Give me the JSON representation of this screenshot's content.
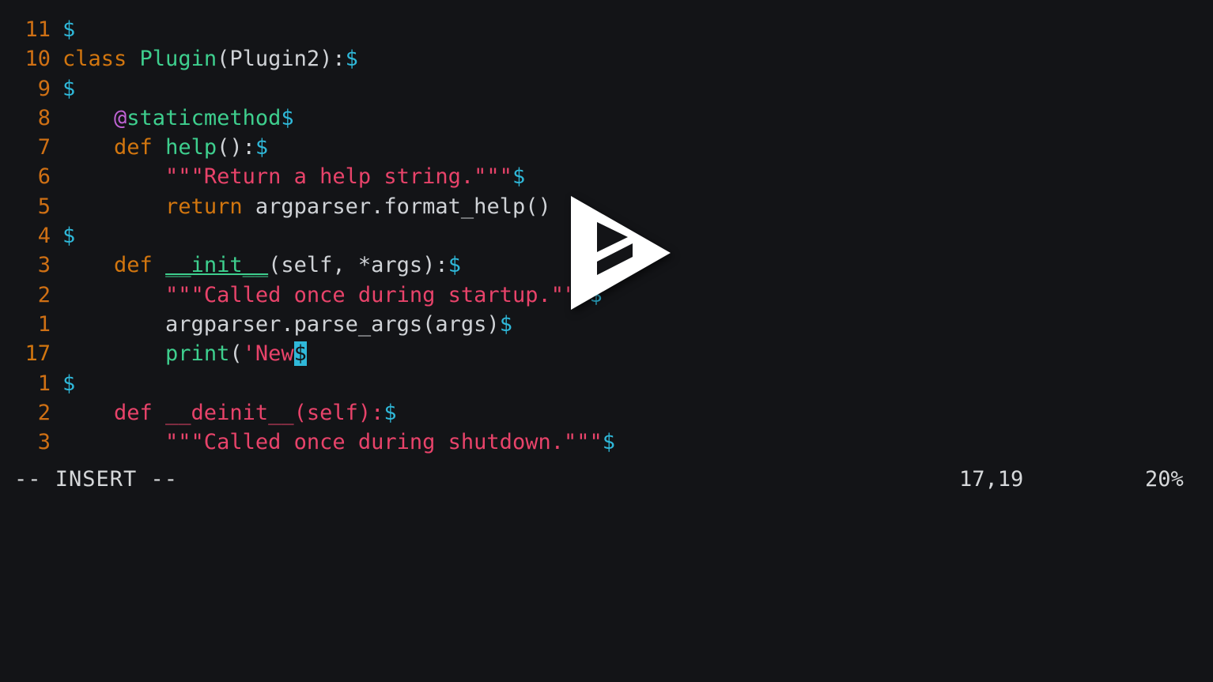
{
  "app": {
    "name": "vim",
    "background_color": "#131417",
    "foreground_color": "#d4d4d4"
  },
  "colors": {
    "keyword": "#d2760f",
    "function": "#3ecf8e",
    "string": "#e8436a",
    "decorator": "#bf63d4",
    "plain_text": "#cfd2d6",
    "eol_marker": "#2fb8d9",
    "line_number": "#cf7014",
    "cursor_background": "#2fb8d9",
    "status_text": "#d6d8da",
    "overlay_icon": "#ffffff"
  },
  "editor": {
    "eol_marker": "$",
    "lines": [
      {
        "number": "11",
        "is_cursor_line": false,
        "tokens": [
          {
            "text": "",
            "type": "plain"
          },
          {
            "text": "$",
            "type": "eol"
          }
        ]
      },
      {
        "number": "10",
        "is_cursor_line": false,
        "tokens": [
          {
            "text": "class ",
            "type": "keyword"
          },
          {
            "text": "Plugin",
            "type": "function"
          },
          {
            "text": "(Plugin2):",
            "type": "plain"
          },
          {
            "text": "$",
            "type": "eol"
          }
        ]
      },
      {
        "number": "9",
        "is_cursor_line": false,
        "tokens": [
          {
            "text": "",
            "type": "plain"
          },
          {
            "text": "$",
            "type": "eol"
          }
        ]
      },
      {
        "number": "8",
        "is_cursor_line": false,
        "tokens": [
          {
            "text": "    ",
            "type": "plain"
          },
          {
            "text": "@",
            "type": "decorator"
          },
          {
            "text": "staticmethod",
            "type": "function"
          },
          {
            "text": "$",
            "type": "eol"
          }
        ]
      },
      {
        "number": "7",
        "is_cursor_line": false,
        "tokens": [
          {
            "text": "    ",
            "type": "plain"
          },
          {
            "text": "def ",
            "type": "keyword"
          },
          {
            "text": "help",
            "type": "function"
          },
          {
            "text": "():",
            "type": "plain"
          },
          {
            "text": "$",
            "type": "eol"
          }
        ]
      },
      {
        "number": "6",
        "is_cursor_line": false,
        "tokens": [
          {
            "text": "        ",
            "type": "plain"
          },
          {
            "text": "\"\"\"Return a help string.\"\"\"",
            "type": "string"
          },
          {
            "text": "$",
            "type": "eol"
          }
        ]
      },
      {
        "number": "5",
        "is_cursor_line": false,
        "tokens": [
          {
            "text": "        ",
            "type": "plain"
          },
          {
            "text": "return ",
            "type": "keyword"
          },
          {
            "text": "argparser.format_help()",
            "type": "plain"
          }
        ]
      },
      {
        "number": "4",
        "is_cursor_line": false,
        "tokens": [
          {
            "text": "",
            "type": "plain"
          },
          {
            "text": "$",
            "type": "eol"
          }
        ]
      },
      {
        "number": "3",
        "is_cursor_line": false,
        "tokens": [
          {
            "text": "    ",
            "type": "plain"
          },
          {
            "text": "def ",
            "type": "keyword"
          },
          {
            "text": "__init__",
            "type": "function-underline"
          },
          {
            "text": "(self, *args):",
            "type": "plain"
          },
          {
            "text": "$",
            "type": "eol"
          }
        ]
      },
      {
        "number": "2",
        "is_cursor_line": false,
        "tokens": [
          {
            "text": "        ",
            "type": "plain"
          },
          {
            "text": "\"\"\"Called once during startup.\"\"\"",
            "type": "string"
          },
          {
            "text": "$",
            "type": "eol"
          }
        ]
      },
      {
        "number": "1",
        "is_cursor_line": false,
        "tokens": [
          {
            "text": "        argparser.parse_args(args)",
            "type": "plain"
          },
          {
            "text": "$",
            "type": "eol"
          }
        ]
      },
      {
        "number": "17",
        "is_cursor_line": true,
        "tokens": [
          {
            "text": "        ",
            "type": "plain"
          },
          {
            "text": "print",
            "type": "builtin"
          },
          {
            "text": "(",
            "type": "plain"
          },
          {
            "text": "'New",
            "type": "string"
          },
          {
            "text": "$",
            "type": "cursor"
          }
        ]
      },
      {
        "number": "1",
        "is_cursor_line": false,
        "tokens": [
          {
            "text": "",
            "type": "plain"
          },
          {
            "text": "$",
            "type": "eol"
          }
        ]
      },
      {
        "number": "2",
        "is_cursor_line": false,
        "tokens": [
          {
            "text": "    def __deinit__(self):",
            "type": "string"
          },
          {
            "text": "$",
            "type": "eol"
          }
        ]
      },
      {
        "number": "3",
        "is_cursor_line": false,
        "tokens": [
          {
            "text": "        \"\"\"Called once during shutdown.\"\"\"",
            "type": "string"
          },
          {
            "text": "$",
            "type": "eol"
          }
        ]
      }
    ]
  },
  "statusline": {
    "mode": "-- INSERT --",
    "ruler": "17,19",
    "percent": "20%"
  },
  "overlay": {
    "icon": "play-triangle-icon",
    "label": "Play"
  }
}
